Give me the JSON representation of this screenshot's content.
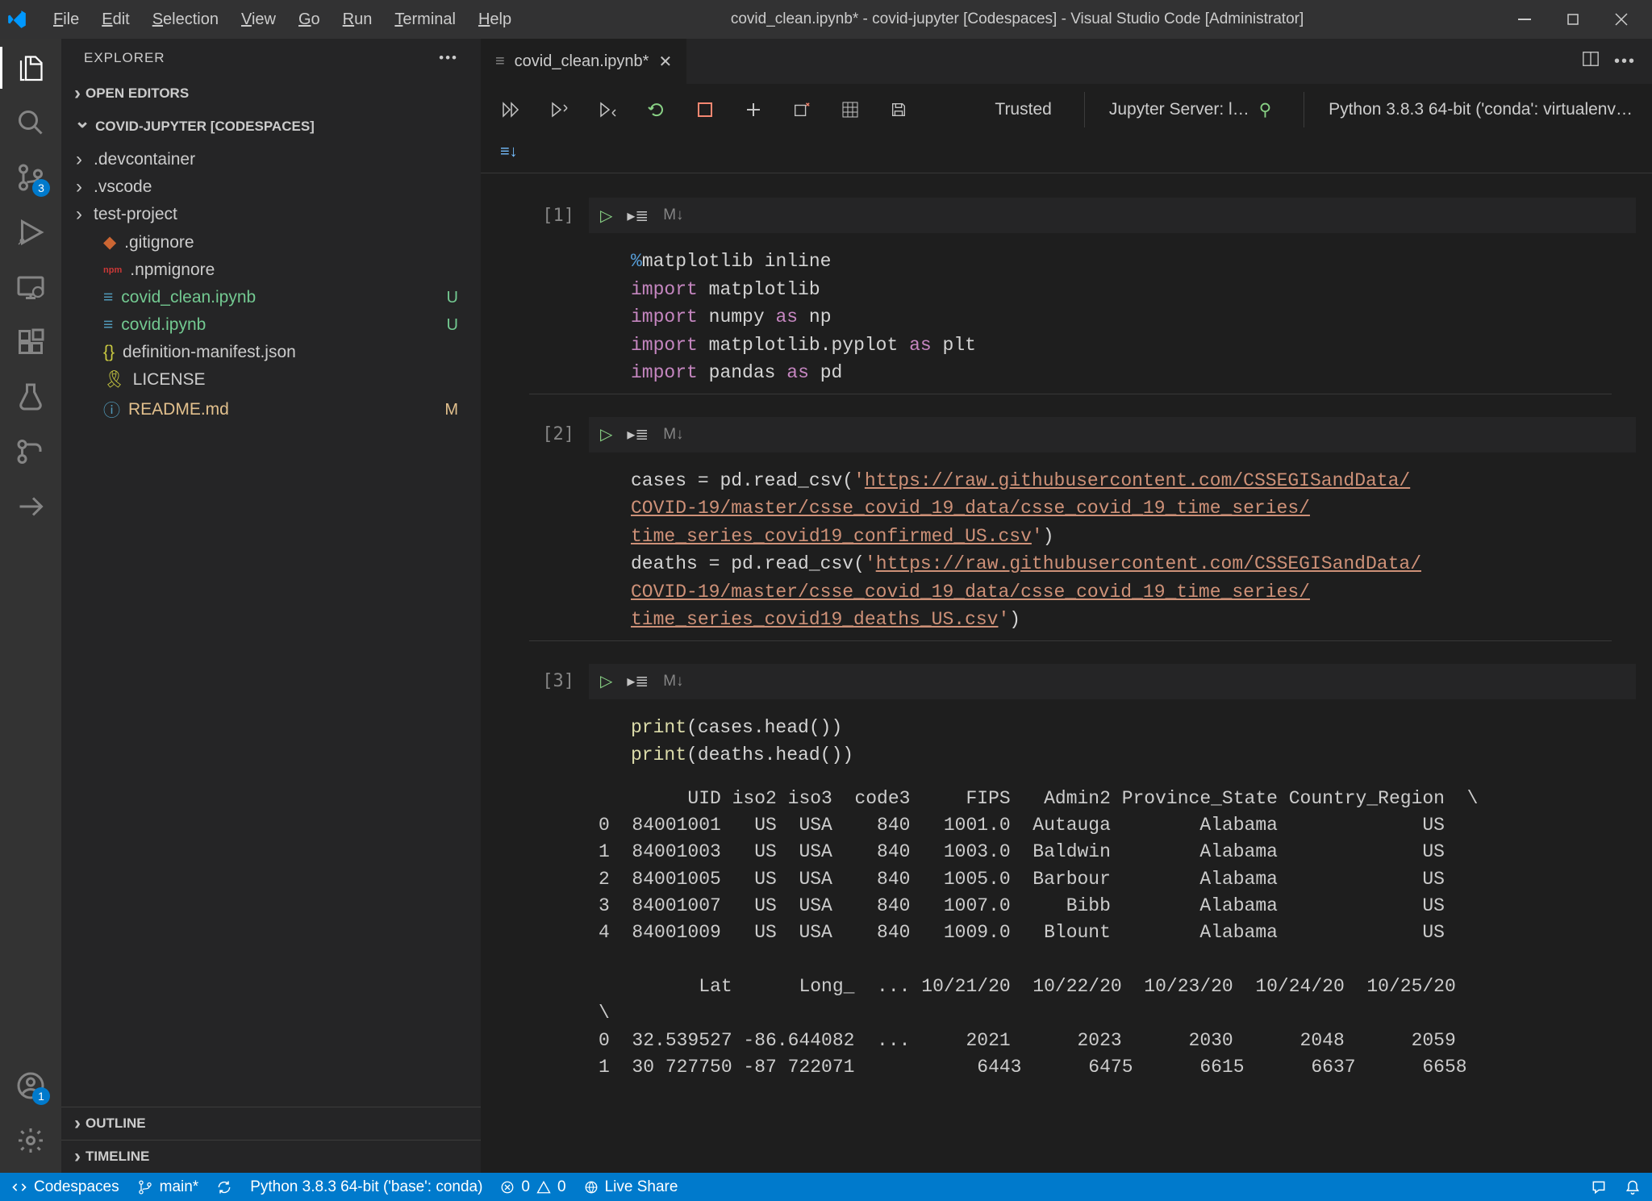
{
  "titlebar": {
    "title": "covid_clean.ipynb* - covid-jupyter [Codespaces] - Visual Studio Code [Administrator]"
  },
  "menu": {
    "file": "File",
    "edit": "Edit",
    "selection": "Selection",
    "view": "View",
    "go": "Go",
    "run": "Run",
    "terminal": "Terminal",
    "help": "Help"
  },
  "activity": {
    "scm_badge": "3",
    "accounts_badge": "1"
  },
  "sidebar": {
    "title": "EXPLORER",
    "open_editors": "OPEN EDITORS",
    "workspace": "COVID-JUPYTER [CODESPACES]",
    "folders": [
      {
        "name": ".devcontainer"
      },
      {
        "name": ".vscode"
      },
      {
        "name": "test-project"
      }
    ],
    "files": [
      {
        "name": ".gitignore",
        "icon": "git",
        "status": ""
      },
      {
        "name": ".npmignore",
        "icon": "npm",
        "status": ""
      },
      {
        "name": "covid_clean.ipynb",
        "icon": "nb",
        "status": "U",
        "green": true
      },
      {
        "name": "covid.ipynb",
        "icon": "nb",
        "status": "U",
        "green": true
      },
      {
        "name": "definition-manifest.json",
        "icon": "json",
        "status": ""
      },
      {
        "name": "LICENSE",
        "icon": "lic",
        "status": ""
      },
      {
        "name": "README.md",
        "icon": "md",
        "status": "M",
        "yellow": true
      }
    ],
    "outline": "OUTLINE",
    "timeline": "TIMELINE"
  },
  "tab": {
    "name": "covid_clean.ipynb*"
  },
  "notebook": {
    "trusted": "Trusted",
    "server": "Jupyter Server: l…",
    "kernel": "Python 3.8.3 64-bit ('conda': virtualenv…"
  },
  "cells": {
    "c1": {
      "prompt": "[1]"
    },
    "c2": {
      "prompt": "[2]"
    },
    "c3": {
      "prompt": "[3]"
    }
  },
  "output3": "        UID iso2 iso3  code3     FIPS   Admin2 Province_State Country_Region  \\\n0  84001001   US  USA    840   1001.0  Autauga        Alabama             US\n1  84001003   US  USA    840   1003.0  Baldwin        Alabama             US\n2  84001005   US  USA    840   1005.0  Barbour        Alabama             US\n3  84001007   US  USA    840   1007.0     Bibb        Alabama             US\n4  84001009   US  USA    840   1009.0   Blount        Alabama             US\n\n         Lat      Long_  ... 10/21/20  10/22/20  10/23/20  10/24/20  10/25/20\n\\\n0  32.539527 -86.644082  ...     2021      2023      2030      2048      2059\n1  30 727750 -87 722071           6443      6475      6615      6637      6658",
  "status": {
    "codespaces": "Codespaces",
    "branch": "main*",
    "python": "Python 3.8.3 64-bit ('base': conda)",
    "errors": "0",
    "warnings": "0",
    "liveshare": "Live Share"
  }
}
